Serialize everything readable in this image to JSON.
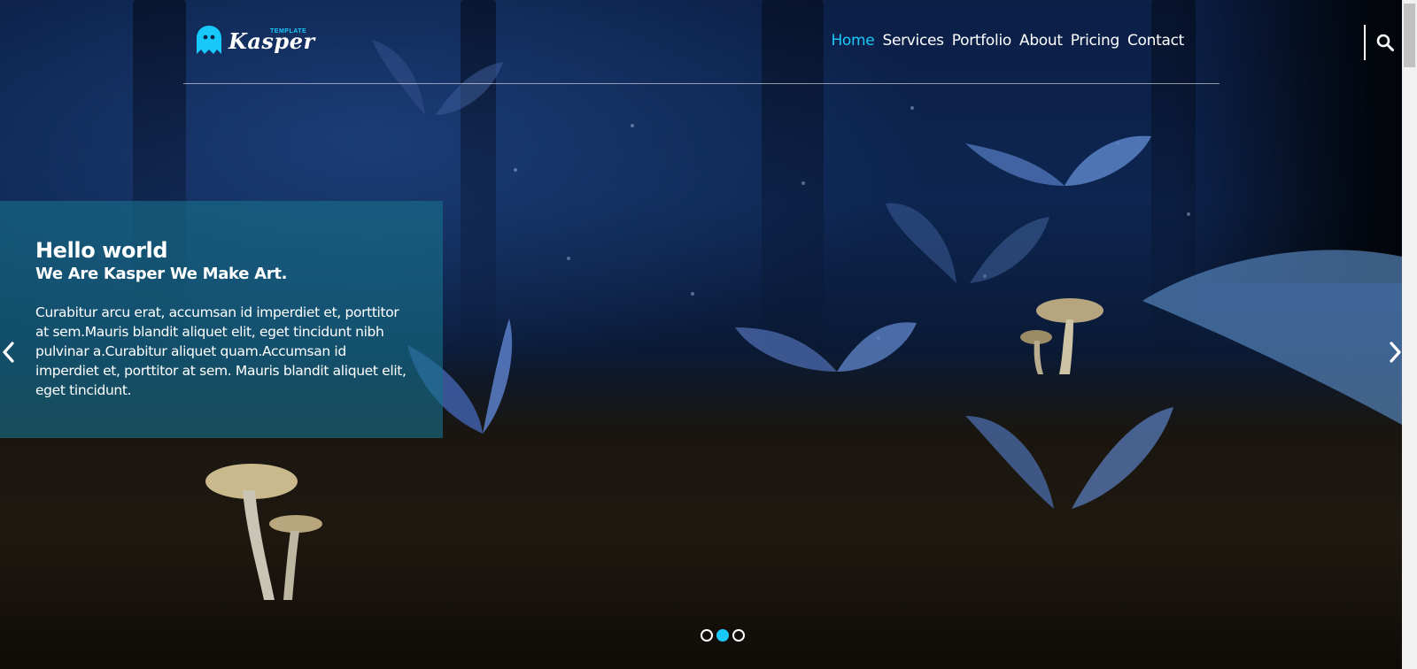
{
  "logo": {
    "name": "Kasper",
    "tag": "TEMPLATE"
  },
  "nav": {
    "items": [
      {
        "label": "Home",
        "active": true
      },
      {
        "label": "Services",
        "active": false
      },
      {
        "label": "Portfolio",
        "active": false
      },
      {
        "label": "About",
        "active": false
      },
      {
        "label": "Pricing",
        "active": false
      },
      {
        "label": "Contact",
        "active": false
      }
    ]
  },
  "search": {
    "icon": "search-icon"
  },
  "slide": {
    "title": "Hello world",
    "subtitle": "We Are Kasper We Make Art.",
    "body": "Curabitur arcu erat, accumsan id imperdiet et, porttitor at sem.Mauris blandit aliquet elit, eget tincidunt nibh pulvinar a.Curabitur aliquet quam.Accumsan id imperdiet et, porttitor at sem. Mauris blandit aliquet elit, eget tincidunt."
  },
  "slider": {
    "prev_icon": "chevron-left-icon",
    "next_icon": "chevron-right-icon",
    "total": 3,
    "current": 2
  },
  "colors": {
    "accent": "#19c8fa",
    "panel": "#19708a",
    "text": "#ffffff"
  }
}
